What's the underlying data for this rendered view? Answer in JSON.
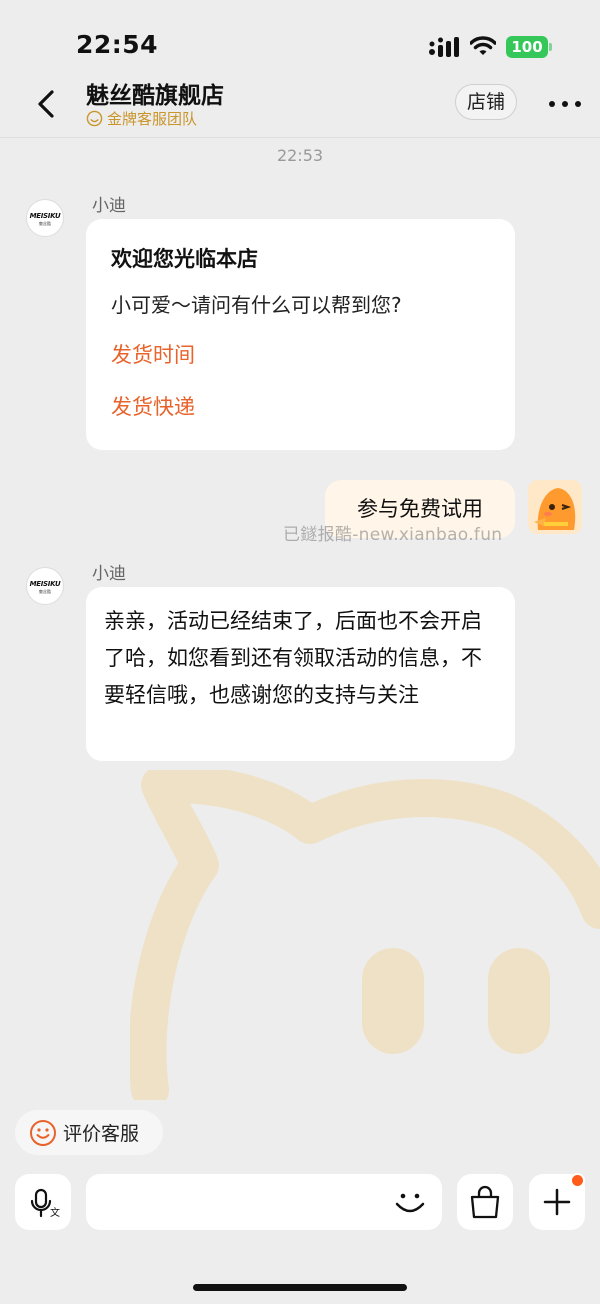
{
  "status_bar": {
    "time": "22:54",
    "battery": "100"
  },
  "header": {
    "title": "魅丝酷旗舰店",
    "subtitle": "金牌客服团队",
    "store_button": "店铺"
  },
  "chat": {
    "timestamp": "22:53",
    "agent_name": "小迪",
    "agent_avatar_brand": "MEISIKU",
    "agent_avatar_sub": "魅丝酷",
    "welcome": {
      "title": "欢迎您光临本店",
      "text": "小可爱～请问有什么可以帮到您?",
      "links": [
        "发货时间",
        "发货快递"
      ]
    },
    "user_message": "参与免费试用",
    "overlay_watermark": "已鐩报酷-new.xianbao.fun",
    "agent_reply_name": "小迪",
    "agent_reply": "亲亲，活动已经结束了，后面也不会开启了哈，如您看到还有领取活动的信息，不要轻信哦，也感谢您的支持与关注"
  },
  "rate_chip": {
    "label": "评价客服"
  },
  "input": {
    "placeholder": ""
  },
  "colors": {
    "accent": "#e8632b",
    "gold": "#c9962c",
    "background": "#ededed",
    "user_bubble": "#fff5e8"
  },
  "icons": [
    "back-icon",
    "more-icon",
    "signal-icon",
    "wifi-icon",
    "smile-icon",
    "voice-translate-icon",
    "emoji-icon",
    "shopping-bag-icon",
    "plus-icon"
  ]
}
